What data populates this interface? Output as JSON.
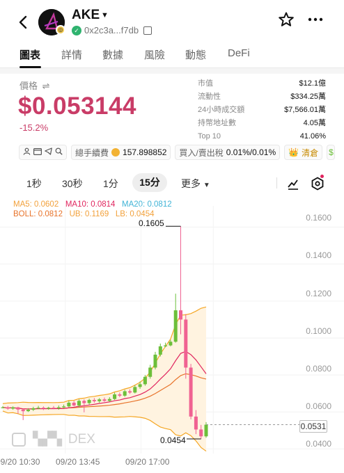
{
  "header": {
    "token_symbol": "AKE",
    "address": "0x2c3a...f7db",
    "back_icon": "chevron-left-icon",
    "star_icon": "star-outline-icon",
    "more_icon": "more-horizontal-icon"
  },
  "tabs": [
    {
      "label": "圖表",
      "active": true
    },
    {
      "label": "詳情"
    },
    {
      "label": "數據"
    },
    {
      "label": "風險"
    },
    {
      "label": "動態"
    },
    {
      "label": "DeFi"
    }
  ],
  "price": {
    "label": "價格",
    "value": "$0.053144",
    "change": "-15.2%",
    "color": "#c93c67"
  },
  "stats": [
    {
      "label": "市值",
      "value": "$12.1億"
    },
    {
      "label": "流動性",
      "value": "$334.25萬"
    },
    {
      "label": "24小時成交額",
      "value": "$7,566.01萬"
    },
    {
      "label": "持幣地址數",
      "value": "4.05萬"
    },
    {
      "label": "Top 10",
      "value": "41.06%"
    }
  ],
  "infobar": {
    "fee_label": "總手續費",
    "fee_value": "157.898852",
    "tax_label": "買入/賣出稅",
    "tax_value": "0.01%/0.01%",
    "clear_label": "清倉"
  },
  "intervals": {
    "items": [
      "1秒",
      "30秒",
      "1分"
    ],
    "active": "15分",
    "more": "更多"
  },
  "indicators": {
    "ma5": "MA5: 0.0602",
    "ma10": "MA10: 0.0814",
    "ma20": "MA20: 0.0812",
    "boll": "BOLL: 0.0812",
    "ub": "UB: 0.1169",
    "lb": "LB: 0.0454"
  },
  "chart_data": {
    "type": "candlestick",
    "y_ticks": [
      "0.1600",
      "0.1400",
      "0.1200",
      "0.1000",
      "0.0800",
      "0.0600",
      "0.0400"
    ],
    "ylim": [
      0.0375,
      0.1715
    ],
    "x_ticks": [
      "09/20 10:30",
      "09/20 13:45",
      "09/20 17:00"
    ],
    "high_annotation": "0.1605",
    "low_annotation": "0.0454",
    "current_price_label": "0.0531",
    "watermark": "DEX",
    "colors": {
      "up": "#6cbf3a",
      "down": "#f06292",
      "boll_band": "#fff3e0",
      "ub": "#f5a623",
      "ma10": "#e0245e",
      "boll_mid": "#e8732a"
    },
    "candles": [
      {
        "o": 0.0625,
        "c": 0.0625,
        "h": 0.0632,
        "l": 0.062
      },
      {
        "o": 0.0625,
        "c": 0.0618,
        "h": 0.0632,
        "l": 0.0612
      },
      {
        "o": 0.0618,
        "c": 0.0625,
        "h": 0.063,
        "l": 0.0612
      },
      {
        "o": 0.0625,
        "c": 0.0613,
        "h": 0.0628,
        "l": 0.059
      },
      {
        "o": 0.0613,
        "c": 0.0604,
        "h": 0.0618,
        "l": 0.0556
      },
      {
        "o": 0.0604,
        "c": 0.0612,
        "h": 0.062,
        "l": 0.06
      },
      {
        "o": 0.0612,
        "c": 0.062,
        "h": 0.0628,
        "l": 0.0605
      },
      {
        "o": 0.062,
        "c": 0.0623,
        "h": 0.0633,
        "l": 0.0615
      },
      {
        "o": 0.0623,
        "c": 0.0618,
        "h": 0.063,
        "l": 0.061
      },
      {
        "o": 0.0618,
        "c": 0.0623,
        "h": 0.0628,
        "l": 0.0612
      },
      {
        "o": 0.0623,
        "c": 0.062,
        "h": 0.0632,
        "l": 0.0615
      },
      {
        "o": 0.062,
        "c": 0.0625,
        "h": 0.0635,
        "l": 0.0612
      },
      {
        "o": 0.0625,
        "c": 0.063,
        "h": 0.064,
        "l": 0.062
      },
      {
        "o": 0.063,
        "c": 0.065,
        "h": 0.066,
        "l": 0.0625
      },
      {
        "o": 0.065,
        "c": 0.0635,
        "h": 0.066,
        "l": 0.063
      },
      {
        "o": 0.0635,
        "c": 0.066,
        "h": 0.0668,
        "l": 0.0625
      },
      {
        "o": 0.066,
        "c": 0.0648,
        "h": 0.0668,
        "l": 0.0598
      },
      {
        "o": 0.0648,
        "c": 0.0665,
        "h": 0.0672,
        "l": 0.064
      },
      {
        "o": 0.0665,
        "c": 0.0658,
        "h": 0.0675,
        "l": 0.065
      },
      {
        "o": 0.0658,
        "c": 0.0668,
        "h": 0.0675,
        "l": 0.065
      },
      {
        "o": 0.0668,
        "c": 0.066,
        "h": 0.0678,
        "l": 0.0655
      },
      {
        "o": 0.066,
        "c": 0.067,
        "h": 0.068,
        "l": 0.0655
      },
      {
        "o": 0.067,
        "c": 0.0695,
        "h": 0.0705,
        "l": 0.0665
      },
      {
        "o": 0.0695,
        "c": 0.0688,
        "h": 0.0705,
        "l": 0.068
      },
      {
        "o": 0.0688,
        "c": 0.0712,
        "h": 0.072,
        "l": 0.0682
      },
      {
        "o": 0.0712,
        "c": 0.0705,
        "h": 0.0722,
        "l": 0.0698
      },
      {
        "o": 0.0705,
        "c": 0.0735,
        "h": 0.0745,
        "l": 0.07
      },
      {
        "o": 0.0735,
        "c": 0.075,
        "h": 0.0765,
        "l": 0.0725
      },
      {
        "o": 0.075,
        "c": 0.079,
        "h": 0.08,
        "l": 0.0742
      },
      {
        "o": 0.079,
        "c": 0.084,
        "h": 0.0855,
        "l": 0.078
      },
      {
        "o": 0.084,
        "c": 0.091,
        "h": 0.0925,
        "l": 0.083
      },
      {
        "o": 0.091,
        "c": 0.0955,
        "h": 0.097,
        "l": 0.09
      },
      {
        "o": 0.0955,
        "c": 0.096,
        "h": 0.0975,
        "l": 0.095
      },
      {
        "o": 0.096,
        "c": 0.098,
        "h": 0.099,
        "l": 0.0955
      },
      {
        "o": 0.098,
        "c": 0.115,
        "h": 0.124,
        "l": 0.0975
      },
      {
        "o": 0.115,
        "c": 0.11,
        "h": 0.1605,
        "l": 0.102
      },
      {
        "o": 0.11,
        "c": 0.084,
        "h": 0.113,
        "l": 0.078
      },
      {
        "o": 0.084,
        "c": 0.0575,
        "h": 0.086,
        "l": 0.056
      },
      {
        "o": 0.0575,
        "c": 0.0505,
        "h": 0.061,
        "l": 0.048
      },
      {
        "o": 0.0505,
        "c": 0.0468,
        "h": 0.053,
        "l": 0.0454
      },
      {
        "o": 0.0468,
        "c": 0.0531,
        "h": 0.0545,
        "l": 0.046
      }
    ]
  }
}
